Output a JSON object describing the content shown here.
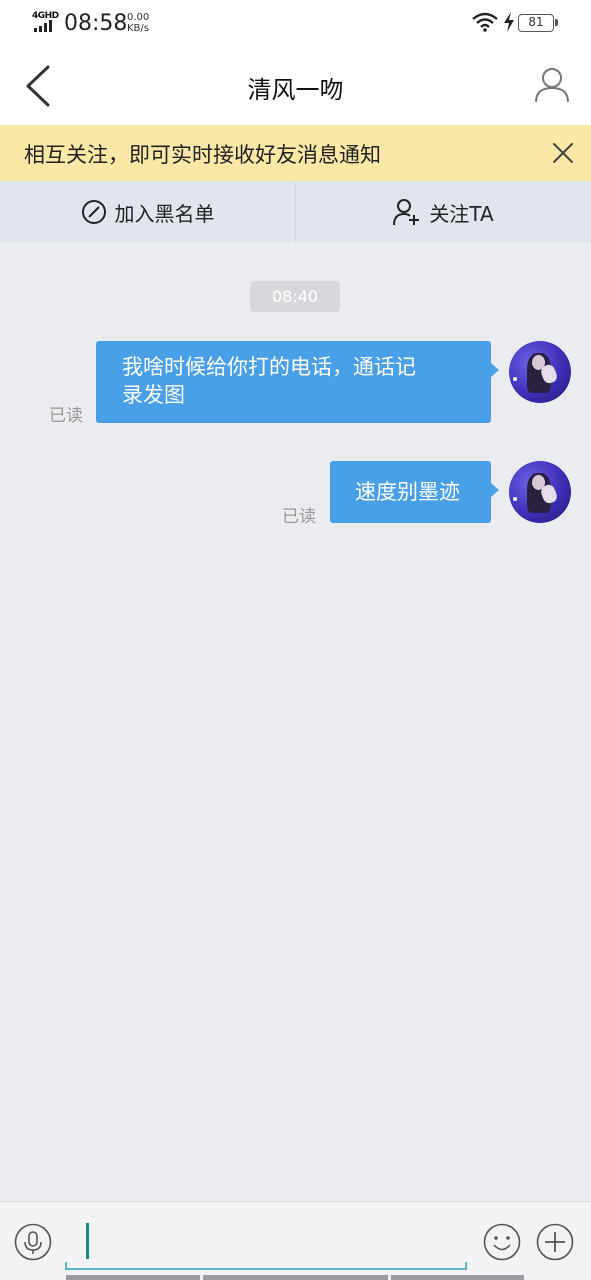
{
  "status": {
    "network": "4GHD",
    "time": "08:58",
    "speed_value": "0.00",
    "speed_unit": "KB/s",
    "battery": "81"
  },
  "header": {
    "title": "清风一吻"
  },
  "notice": {
    "text": "相互关注，即可实时接收好友消息通知"
  },
  "actions": {
    "blacklist_label": "加入黑名单",
    "follow_label": "关注TA"
  },
  "chat": {
    "timestamp": "08:40",
    "messages": [
      {
        "lines": [
          "我啥时候给你打的电话，通话记",
          "录发图"
        ],
        "read": "已读"
      },
      {
        "lines": [
          "速度别墨迹"
        ],
        "read": "已读"
      }
    ]
  },
  "input": {
    "value": ""
  }
}
